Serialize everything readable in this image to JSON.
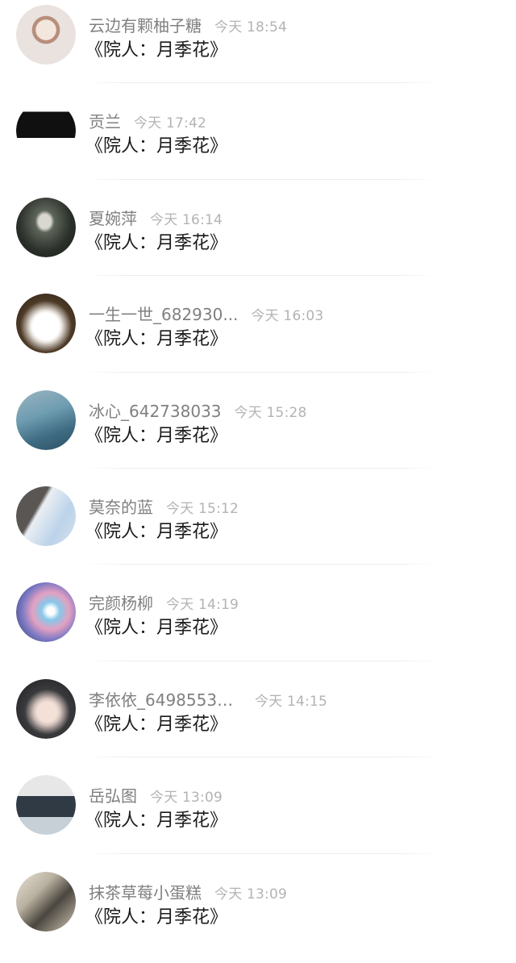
{
  "comments": [
    {
      "username": "云边有颗柚子糖",
      "time": "今天 18:54",
      "message": "《院人：月季花》",
      "avatar_icon": "avatar-image"
    },
    {
      "username": "贡兰",
      "time": "今天 17:42",
      "message": "《院人：月季花》",
      "avatar_icon": "avatar-image"
    },
    {
      "username": "夏婉萍",
      "time": "今天 16:14",
      "message": "《院人：月季花》",
      "avatar_icon": "avatar-image"
    },
    {
      "username": "一生一世_682930...",
      "time": "今天 16:03",
      "message": "《院人：月季花》",
      "avatar_icon": "avatar-image"
    },
    {
      "username": "冰心_642738033",
      "time": "今天 15:28",
      "message": "《院人：月季花》",
      "avatar_icon": "avatar-image"
    },
    {
      "username": "莫奈的蓝",
      "time": "今天 15:12",
      "message": "《院人：月季花》",
      "avatar_icon": "avatar-image"
    },
    {
      "username": "完颜杨柳",
      "time": "今天 14:19",
      "message": "《院人：月季花》",
      "avatar_icon": "avatar-image"
    },
    {
      "username": "李依依_64985530...",
      "time": "今天 14:15",
      "message": "《院人：月季花》",
      "avatar_icon": "avatar-image"
    },
    {
      "username": "岳弘图",
      "time": "今天 13:09",
      "message": "《院人：月季花》",
      "avatar_icon": "avatar-image"
    },
    {
      "username": "抹茶草莓小蛋糕",
      "time": "今天 13:09",
      "message": "《院人：月季花》",
      "avatar_icon": "avatar-image"
    }
  ],
  "colors": {
    "username": "#808080",
    "time": "#b3b3b3",
    "message": "#1a1a1a",
    "divider": "#ececec",
    "background": "#ffffff"
  }
}
